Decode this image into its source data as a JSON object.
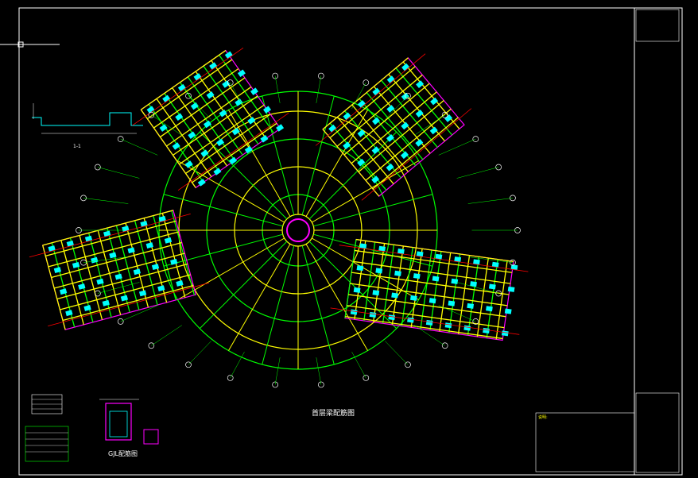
{
  "drawing": {
    "main_title": "首层梁配筋图",
    "detail_title": "GJL配筋图",
    "section_title": "1-1",
    "colors": {
      "background": "#000000",
      "frame": "#ffffff",
      "beam_outline": "#ffff00",
      "grid_axis": "#00ff00",
      "rebar_note": "#00ffff",
      "column": "#ff00ff",
      "axis_line": "#ff0000"
    }
  },
  "notes": {
    "heading": "说明:",
    "lines": [
      "",
      "",
      "",
      "",
      "",
      "",
      "",
      "",
      ""
    ]
  },
  "title_block": {
    "rows": [
      "",
      "",
      "",
      "",
      ""
    ]
  }
}
